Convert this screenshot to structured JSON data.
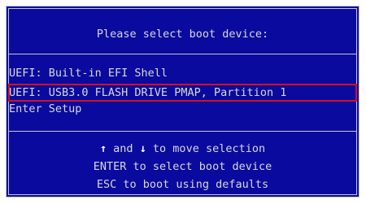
{
  "boot_menu": {
    "title": "Please select boot device:",
    "options": [
      {
        "label": "UEFI: Built-in EFI Shell"
      },
      {
        "label": "UEFI: USB3.0 FLASH DRIVE PMAP, Partition 1"
      },
      {
        "label": "Enter Setup"
      }
    ],
    "selected_index": 1,
    "help": {
      "up_arrow": "↑",
      "and_text": " and ",
      "down_arrow": "↓",
      "move_text": " to move selection",
      "enter_line": "ENTER to select boot device",
      "esc_line": "ESC to boot using defaults"
    }
  },
  "colors": {
    "background": "#0a0a9e",
    "text": "#d8d8d8",
    "border": "#c8c8c8",
    "highlight_box": "#d4101c"
  }
}
